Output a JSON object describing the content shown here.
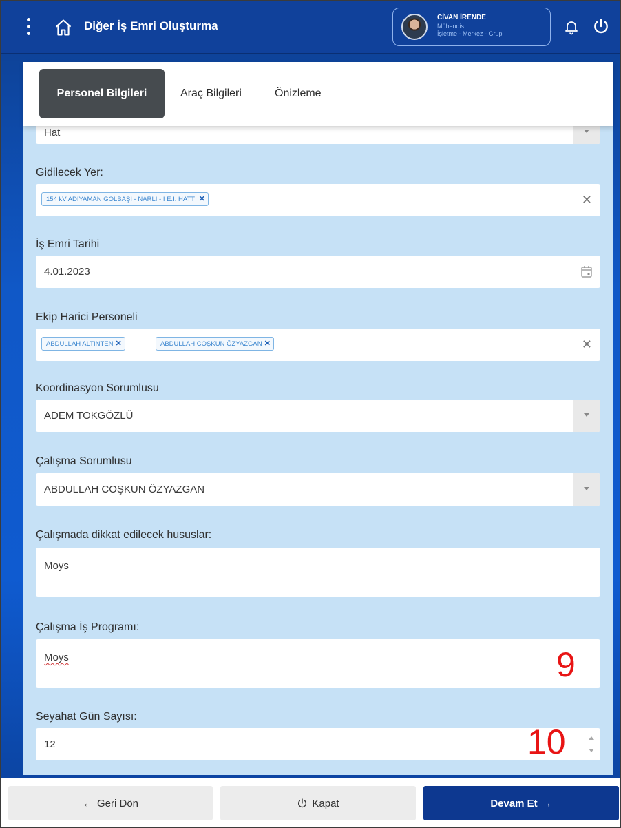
{
  "header": {
    "title": "Diğer İş Emri Oluşturma",
    "user": {
      "name": "CİVAN İRENDE",
      "role": "Mühendis",
      "unit": "İşletme - Merkez - Grup"
    }
  },
  "tabs": [
    {
      "label": "Personel Bilgileri",
      "active": true
    },
    {
      "label": "Araç Bilgileri",
      "active": false
    },
    {
      "label": "Önizleme",
      "active": false
    }
  ],
  "form": {
    "partial_field": {
      "value": "Hat"
    },
    "gidilecek_yer": {
      "label": "Gidilecek Yer:",
      "chips": [
        "154 kV ADIYAMAN GÖLBAŞI - NARLI - I E.İ. HATTI"
      ]
    },
    "is_emri_tarihi": {
      "label": "İş Emri Tarihi",
      "value": "4.01.2023"
    },
    "ekip_harici": {
      "label": "Ekip Harici Personeli",
      "chips": [
        "ABDULLAH ALTINTEN",
        "ABDULLAH COŞKUN ÖZYAZGAN"
      ]
    },
    "koordinasyon": {
      "label": "Koordinasyon Sorumlusu",
      "value": "ADEM TOKGÖZLÜ"
    },
    "calisma_sorumlusu": {
      "label": "Çalışma Sorumlusu",
      "value": "ABDULLAH COŞKUN ÖZYAZGAN"
    },
    "dikkat": {
      "label": "Çalışmada dikkat edilecek hususlar:",
      "value": "Moys"
    },
    "is_programi": {
      "label": "Çalışma İş Programı:",
      "value": "Moys"
    },
    "seyahat": {
      "label": "Seyahat Gün Sayısı:",
      "value": "12"
    }
  },
  "annotations": {
    "nine": "9",
    "ten": "10"
  },
  "footer": {
    "back_label": "Geri Dön",
    "close_label": "Kapat",
    "next_label": "Devam Et"
  },
  "colors": {
    "header_bg": "#10419b",
    "content_bg": "#c6e1f6",
    "primary_button": "#0d3890",
    "annotation_red": "#e81414"
  },
  "icons": [
    "menu-kebab-icon",
    "home-icon",
    "bell-icon",
    "power-icon",
    "calendar-icon",
    "arrow-left-icon",
    "arrow-right-icon"
  ]
}
